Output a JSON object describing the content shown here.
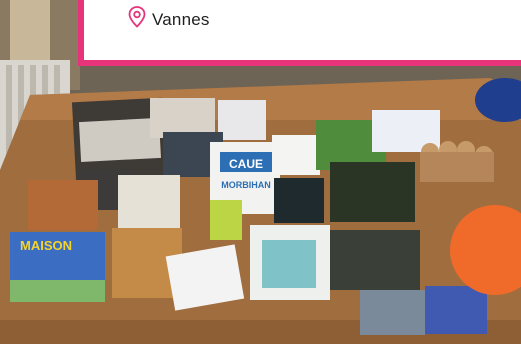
{
  "location": {
    "icon": "map-pin-icon",
    "name": "Vannes"
  },
  "colors": {
    "accent": "#e6337a"
  },
  "photo": {
    "books": [
      {
        "title": "MAISON"
      },
      {
        "title": "CAUE MORBIHAN"
      }
    ]
  }
}
